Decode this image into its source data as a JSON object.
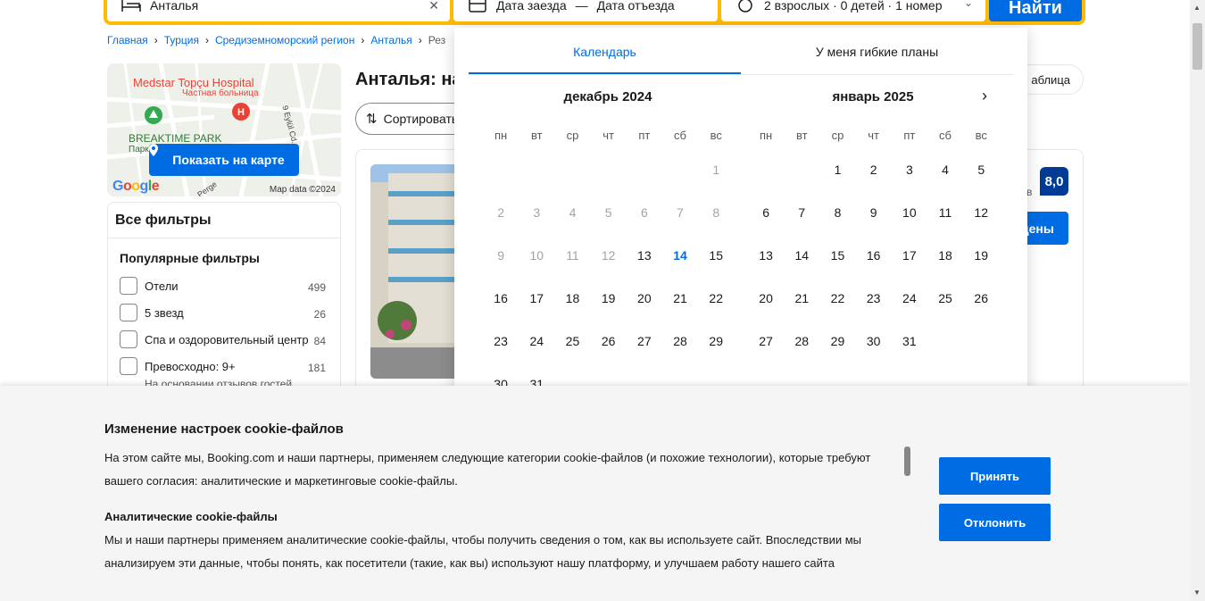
{
  "search": {
    "destination": "Анталья",
    "checkin": "Дата заезда",
    "checkout": "Дата отъезда",
    "guests": "2 взрослых · 0 детей · 1 номер",
    "submit": "Найти"
  },
  "breadcrumb": [
    "Главная",
    "Турция",
    "Средиземноморский регион",
    "Анталья",
    "Рез"
  ],
  "map": {
    "hospital_name": "Medstar Topçu Hospital",
    "hospital_sub": "Частная больница",
    "park_name": "BREAKTIME PARK",
    "park_sub": "Парк",
    "street1": "9 Eylül Cd.",
    "street2": "Perge",
    "google": "Google",
    "attribution": "Map data ©2024",
    "button": "Показать на карте"
  },
  "filters": {
    "title": "Все фильтры",
    "popular_title": "Популярные фильтры",
    "items": [
      {
        "label": "Отели",
        "count": "499"
      },
      {
        "label": "5 звезд",
        "count": "26"
      },
      {
        "label": "Спа и оздоровительный центр",
        "count": "84"
      },
      {
        "label": "Превосходно: 9+",
        "count": "181"
      }
    ],
    "note": "На основании отзывов гостей"
  },
  "results": {
    "title": "Анталья: на",
    "sort": "Сортировать",
    "table_view": "аблица",
    "score_label": "о",
    "score_sub": "в",
    "score": "8,0",
    "price_button": "цены"
  },
  "datepicker": {
    "tabs": [
      "Календарь",
      "У меня гибкие планы"
    ],
    "weekdays": [
      "пн",
      "вт",
      "ср",
      "чт",
      "пт",
      "сб",
      "вс"
    ],
    "months": [
      {
        "title": "декабрь 2024",
        "offset": 6,
        "days": [
          "1",
          "2",
          "3",
          "4",
          "5",
          "6",
          "7",
          "8",
          "9",
          "10",
          "11",
          "12",
          "13",
          "14",
          "15",
          "16",
          "17",
          "18",
          "19",
          "20",
          "21",
          "22",
          "23",
          "24",
          "25",
          "26",
          "27",
          "28",
          "29",
          "30",
          "31"
        ],
        "past_until": 12,
        "today": 14
      },
      {
        "title": "январь 2025",
        "offset": 2,
        "days": [
          "1",
          "2",
          "3",
          "4",
          "5",
          "6",
          "7",
          "8",
          "9",
          "10",
          "11",
          "12",
          "13",
          "14",
          "15",
          "16",
          "17",
          "18",
          "19",
          "20",
          "21",
          "22",
          "23",
          "24",
          "25",
          "26",
          "27",
          "28",
          "29",
          "30",
          "31"
        ],
        "past_until": 0,
        "today": 0
      }
    ]
  },
  "cookie": {
    "title": "Изменение настроек cookie-файлов",
    "body": "На этом сайте мы, Booking.com и наши партнеры, применяем следующие категории cookie-файлов (и похожие технологии), которые требуют вашего согласия: аналитические и маркетинговые cookie-файлы.",
    "analytics_title": "Аналитические cookie-файлы",
    "analytics_body": "Мы и наши партнеры применяем аналитические cookie-файлы, чтобы получить сведения о том, как вы используете сайт. Впоследствии мы анализируем эти данные, чтобы понять, как посетители (такие, как вы) используют нашу платформу, и улучшаем работу нашего сайта",
    "accept": "Принять",
    "reject": "Отклонить"
  },
  "colors": {
    "brand_blue": "#006ce4",
    "search_yellow": "#febb02",
    "score_navy": "#003b95"
  }
}
